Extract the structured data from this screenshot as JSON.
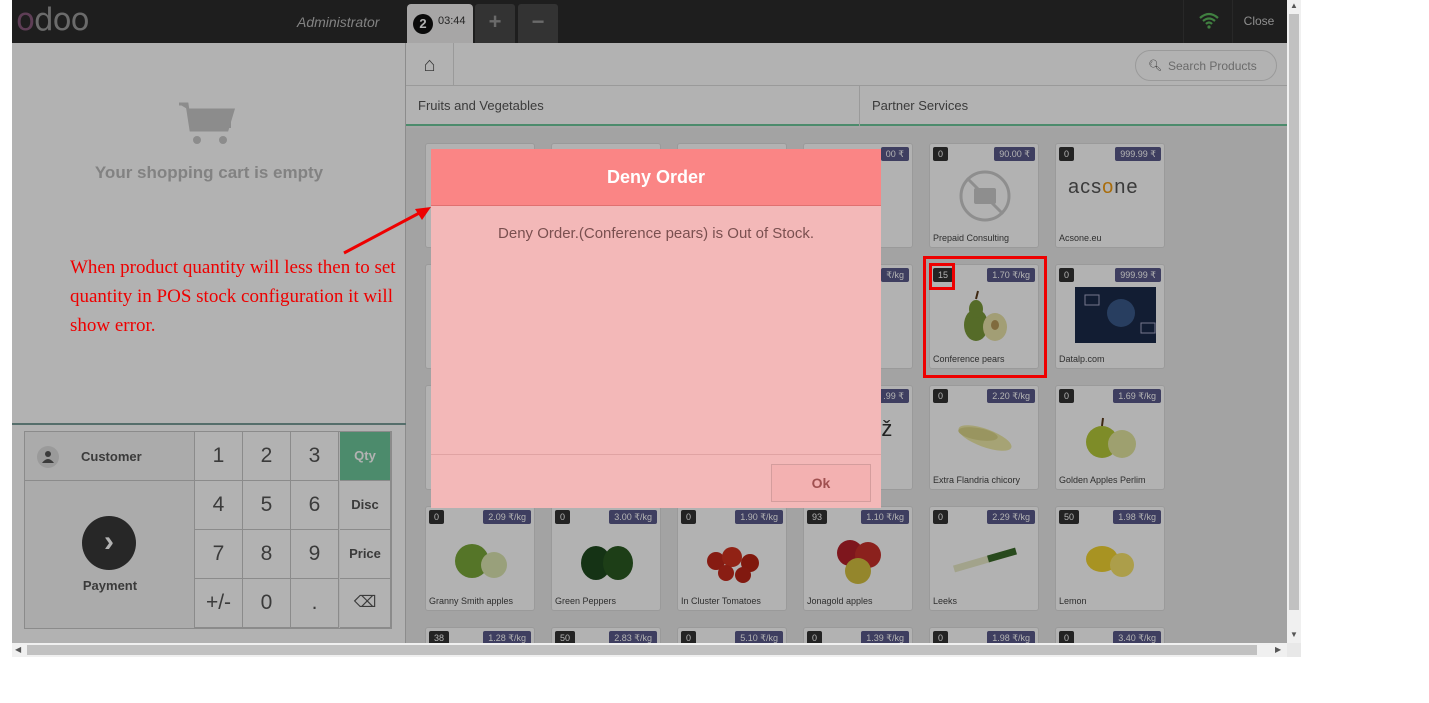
{
  "header": {
    "logo": "odoo",
    "user": "Administrator",
    "order_number": "2",
    "order_time": "03:44",
    "add_label": "+",
    "remove_label": "−",
    "close_label": "Close"
  },
  "cart": {
    "empty_text": "Your shopping cart is empty"
  },
  "numpad": {
    "customer_label": "Customer",
    "payment_label": "Payment",
    "keys": [
      "1",
      "2",
      "3",
      "4",
      "5",
      "6",
      "7",
      "8",
      "9",
      "+/-",
      "0",
      "."
    ],
    "modes": [
      "Qty",
      "Disc",
      "Price"
    ],
    "selected_mode": "Qty"
  },
  "search": {
    "placeholder": "Search Products"
  },
  "categories": [
    "Fruits and Vegetables",
    "Partner Services"
  ],
  "products": [
    {
      "name": "Prepaid Consulting",
      "qty": "0",
      "price": "90.00 ₹",
      "col": 4,
      "row": 0
    },
    {
      "name": "Acsone.eu",
      "qty": "0",
      "price": "999.99 ₹",
      "col": 5,
      "row": 0
    },
    {
      "name": "Conference pears",
      "qty": "15",
      "price": "1.70 ₹/kg",
      "col": 4,
      "row": 1
    },
    {
      "name": "Datalp.com",
      "qty": "0",
      "price": "999.99 ₹",
      "col": 5,
      "row": 1
    },
    {
      "name": "Extra Flandria chicory",
      "qty": "0",
      "price": "2.20 ₹/kg",
      "col": 4,
      "row": 2
    },
    {
      "name": "Golden Apples Perlim",
      "qty": "0",
      "price": "1.69 ₹/kg",
      "col": 5,
      "row": 2
    },
    {
      "name": "Granny Smith apples",
      "qty": "0",
      "price": "2.09 ₹/kg",
      "col": 0,
      "row": 3
    },
    {
      "name": "Green Peppers",
      "qty": "0",
      "price": "3.00 ₹/kg",
      "col": 1,
      "row": 3
    },
    {
      "name": "In Cluster Tomatoes",
      "qty": "0",
      "price": "1.90 ₹/kg",
      "col": 2,
      "row": 3
    },
    {
      "name": "Jonagold apples",
      "qty": "93",
      "price": "1.10 ₹/kg",
      "col": 3,
      "row": 3
    },
    {
      "name": "Leeks",
      "qty": "0",
      "price": "2.29 ₹/kg",
      "col": 4,
      "row": 3
    },
    {
      "name": "Lemon",
      "qty": "50",
      "price": "1.98 ₹/kg",
      "col": 5,
      "row": 3
    },
    {
      "name": "",
      "qty": "38",
      "price": "1.28 ₹/kg",
      "col": 0,
      "row": 4
    },
    {
      "name": "",
      "qty": "50",
      "price": "2.83 ₹/kg",
      "col": 1,
      "row": 4
    },
    {
      "name": "",
      "qty": "0",
      "price": "5.10 ₹/kg",
      "col": 2,
      "row": 4
    },
    {
      "name": "",
      "qty": "0",
      "price": "1.39 ₹/kg",
      "col": 3,
      "row": 4
    },
    {
      "name": "",
      "qty": "0",
      "price": "1.98 ₹/kg",
      "col": 4,
      "row": 4
    },
    {
      "name": "",
      "qty": "0",
      "price": "3.40 ₹/kg",
      "col": 5,
      "row": 4
    }
  ],
  "partial_texts": {
    "card0_price": "00 ₹",
    "card_row1_price": "₹/kg",
    "card_row2_price": ".99 ₹",
    "card_row2_logo": "rž"
  },
  "dialog": {
    "title": "Deny Order",
    "message": "Deny Order.(Conference pears) is Out of Stock.",
    "ok_label": "Ok"
  },
  "annotation": {
    "text": "When product quantity will less then to set quantity in POS stock configuration it will show error."
  },
  "colors": {
    "dialog_header": "#fa8585",
    "dialog_body": "#f3b8b8",
    "annotation": "#ee0000",
    "accent": "#6ec89b"
  }
}
